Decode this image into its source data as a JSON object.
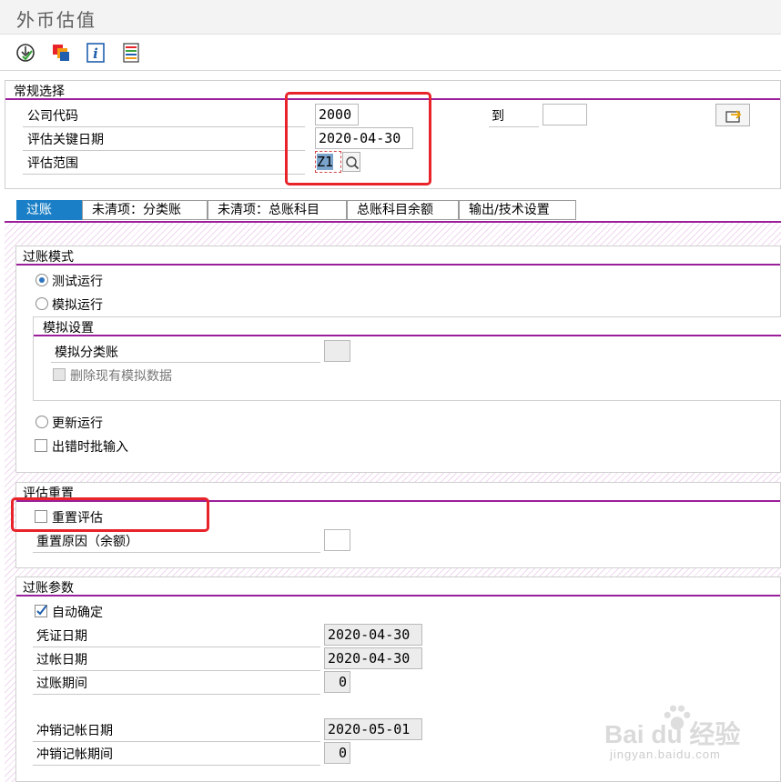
{
  "window": {
    "title": "外币估值"
  },
  "toolbar": {
    "icons": [
      "execute-check-icon",
      "copy-variant-icon",
      "info-icon",
      "list-icon"
    ]
  },
  "general_selection": {
    "title": "常规选择",
    "company_code_label": "公司代码",
    "company_code_value": "2000",
    "to_label": "到",
    "to_value": "",
    "key_date_label": "评估关键日期",
    "key_date_value": "2020-04-30",
    "valuation_area_label": "评估范围",
    "valuation_area_value": "Z1"
  },
  "tabs": [
    {
      "label": "过账",
      "active": true
    },
    {
      "label": "未清项：分类账",
      "active": false
    },
    {
      "label": "未清项：总账科目",
      "active": false
    },
    {
      "label": "总账科目余额",
      "active": false
    },
    {
      "label": "输出/技术设置",
      "active": false
    }
  ],
  "posting_mode": {
    "title": "过账模式",
    "test_run_label": "测试运行",
    "simulation_run_label": "模拟运行",
    "simulation_settings_title": "模拟设置",
    "simulation_ledger_label": "模拟分类账",
    "simulation_ledger_value": "",
    "delete_sim_data_label": "删除现有模拟数据",
    "update_run_label": "更新运行",
    "batch_input_label": "出错时批输入"
  },
  "valuation_reset": {
    "title": "评估重置",
    "reset_valuation_label": "重置评估",
    "reset_reason_label": "重置原因（余额）",
    "reset_reason_value": ""
  },
  "posting_params": {
    "title": "过账参数",
    "auto_confirm_label": "自动确定",
    "doc_date_label": "凭证日期",
    "doc_date_value": "2020-04-30",
    "posting_date_label": "过帐日期",
    "posting_date_value": "2020-04-30",
    "posting_period_label": "过账期间",
    "posting_period_value": "0",
    "reversal_date_label": "冲销记帐日期",
    "reversal_date_value": "2020-05-01",
    "reversal_period_label": "冲销记帐期间",
    "reversal_period_value": "0"
  },
  "watermark": {
    "brand": "Bai du 经验",
    "url": "jingyan.baidu.com"
  }
}
